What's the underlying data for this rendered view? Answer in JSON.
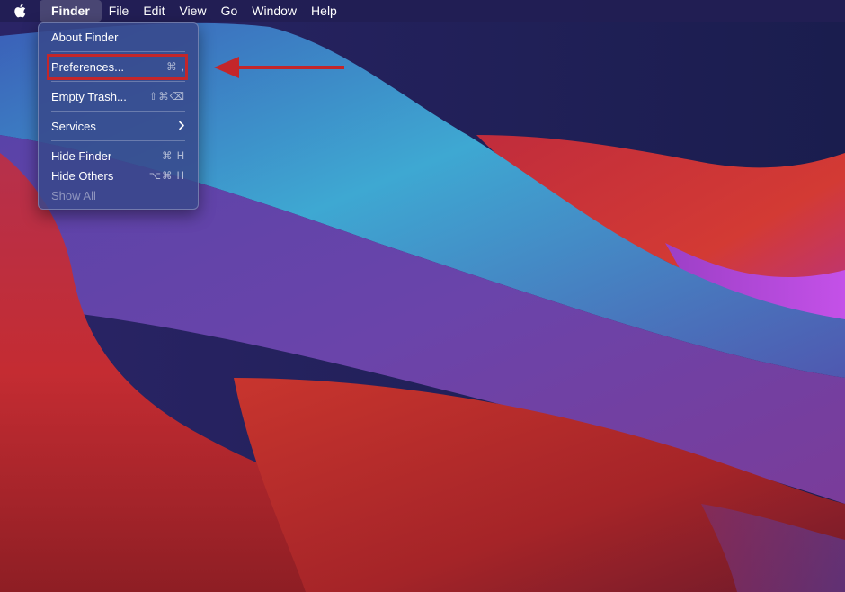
{
  "menubar": {
    "apple_icon": "apple-logo-icon",
    "items": [
      "Finder",
      "File",
      "Edit",
      "View",
      "Go",
      "Window",
      "Help"
    ]
  },
  "finder_menu": {
    "about": "About Finder",
    "preferences": {
      "label": "Preferences...",
      "shortcut": "⌘ ,"
    },
    "empty_trash": {
      "label": "Empty Trash...",
      "shortcut": "⇧⌘⌫"
    },
    "services": {
      "label": "Services",
      "icon": "chevron-right-icon"
    },
    "hide_finder": {
      "label": "Hide Finder",
      "shortcut": "⌘ H"
    },
    "hide_others": {
      "label": "Hide Others",
      "shortcut": "⌥⌘ H"
    },
    "show_all": {
      "label": "Show All",
      "disabled": true
    }
  },
  "annotation": {
    "color": "#c4262a",
    "highlight_target": "preferences",
    "arrow_icon": "arrow-left-icon"
  }
}
